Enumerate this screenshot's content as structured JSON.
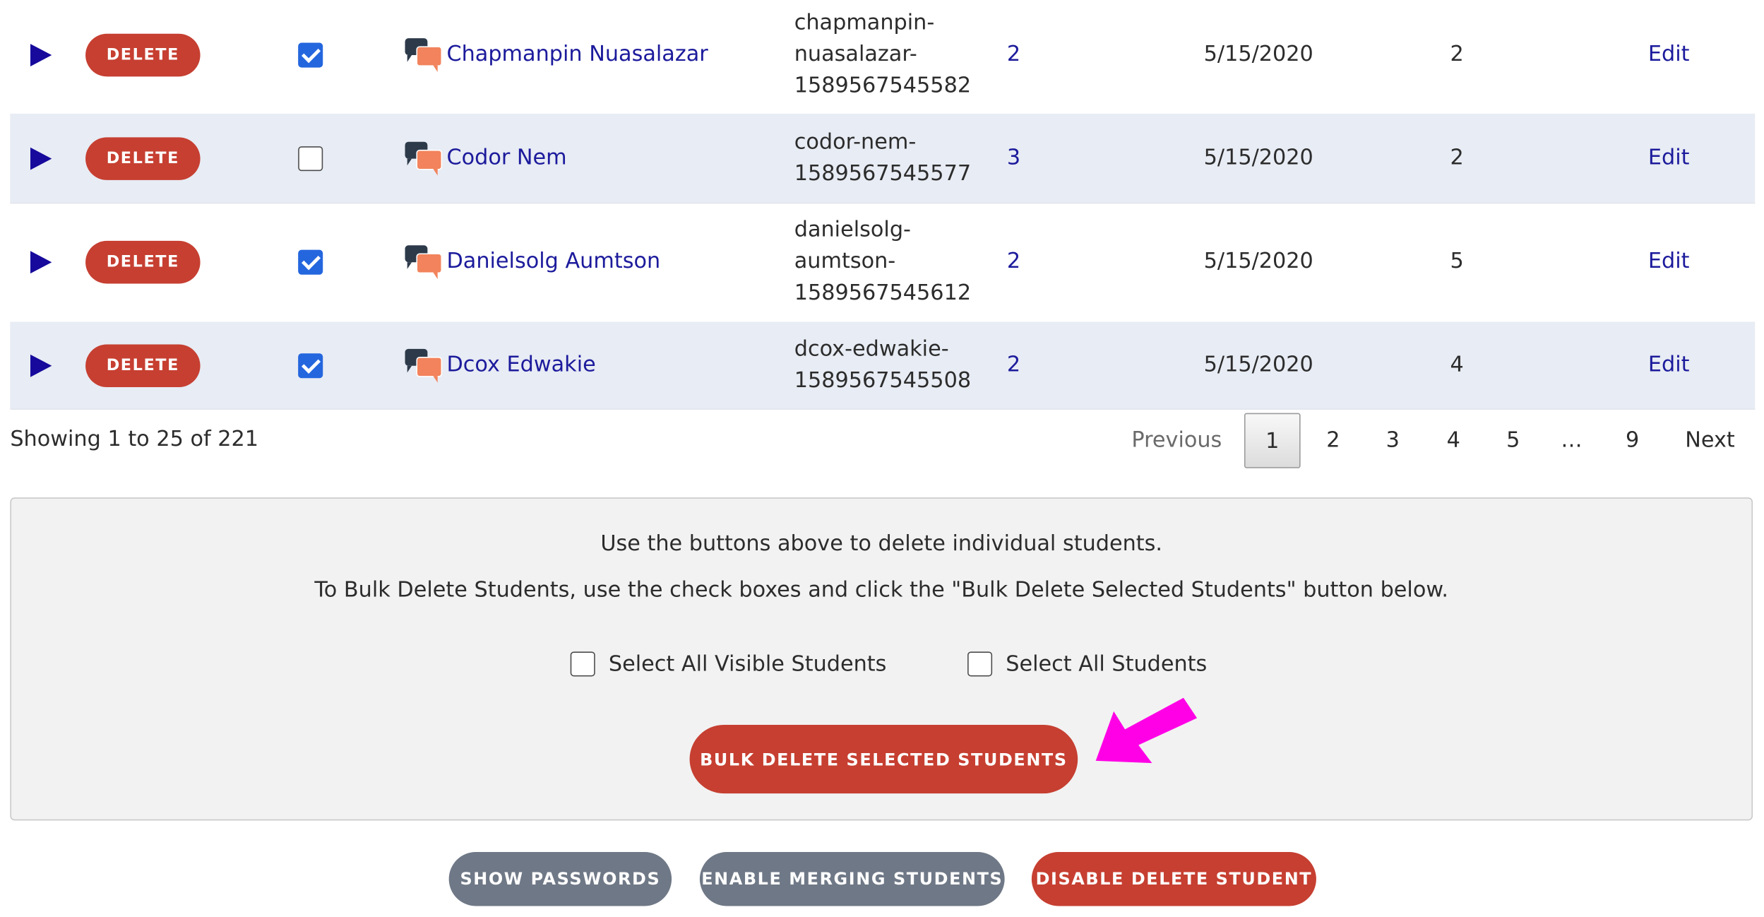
{
  "rows": [
    {
      "delete_label": "DELETE",
      "checked": true,
      "name": "Chapmanpin Nuasalazar",
      "username_lines": [
        "chapmanpin-",
        "nuasalazar-",
        "1589567545582"
      ],
      "link_count": "2",
      "date": "5/15/2020",
      "count": "2",
      "edit_label": "Edit"
    },
    {
      "delete_label": "DELETE",
      "checked": false,
      "name": "Codor Nem",
      "username_lines": [
        "codor-nem-",
        "1589567545577"
      ],
      "link_count": "3",
      "date": "5/15/2020",
      "count": "2",
      "edit_label": "Edit"
    },
    {
      "delete_label": "DELETE",
      "checked": true,
      "name": "Danielsolg Aumtson",
      "username_lines": [
        "danielsolg-",
        "aumtson-",
        "1589567545612"
      ],
      "link_count": "2",
      "date": "5/15/2020",
      "count": "5",
      "edit_label": "Edit"
    },
    {
      "delete_label": "DELETE",
      "checked": true,
      "name": "Dcox Edwakie",
      "username_lines": [
        "dcox-edwakie-",
        "1589567545508"
      ],
      "link_count": "2",
      "date": "5/15/2020",
      "count": "4",
      "edit_label": "Edit"
    }
  ],
  "icons": {
    "expand": "play-triangle-icon",
    "chat": "chat-bubbles-icon",
    "checkbox": "checkbox-icon",
    "arrow": "pointer-arrow-icon"
  },
  "footer": {
    "showing_text": "Showing 1 to 25 of 221",
    "pagination": {
      "previous": "Previous",
      "pages": [
        "1",
        "2",
        "3",
        "4",
        "5",
        "…",
        "9"
      ],
      "current": "1",
      "next": "Next"
    }
  },
  "bulk_panel": {
    "line1": "Use the buttons above to delete individual students.",
    "line2": "To Bulk Delete Students, use the check boxes and click the \"Bulk Delete Selected Students\" button below.",
    "select_visible_label": "Select All Visible Students",
    "select_all_label": "Select All Students",
    "bulk_button_label": "BULK DELETE SELECTED STUDENTS"
  },
  "actions": {
    "show_passwords": "SHOW PASSWORDS",
    "enable_merging": "ENABLE MERGING STUDENTS",
    "disable_delete": "DISABLE DELETE STUDENT"
  },
  "colors": {
    "danger": "#c63f31",
    "link": "#1c1b9c",
    "checkbox_on": "#2466de",
    "row_alt": "#e8ecf4",
    "secondary_button": "#6f7886",
    "annotation_arrow": "#ff00e6"
  }
}
